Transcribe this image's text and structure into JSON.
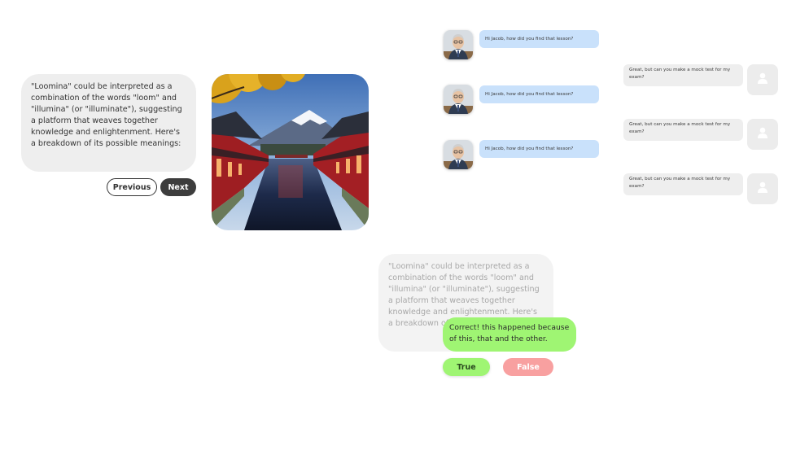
{
  "intro_card": {
    "text": "\"Loomina\" could be interpreted as a combination of the words \"loom\" and \"illumina\" (or \"illuminate\"), suggesting a platform that weaves together knowledge and enlightenment. Here's a breakdown of its possible meanings:"
  },
  "navigation": {
    "previous_label": "Previous",
    "next_label": "Next"
  },
  "chat": {
    "teacher_messages": [
      "Hi Jacob, how did you find that lesson?",
      "Hi Jacob, how did you find that lesson?",
      "Hi Jacob, how did you find that lesson?"
    ],
    "student_messages": [
      "Great, but can you make a mock test for my exam?",
      "Great, but can you make a mock test for my exam?",
      "Great, but can you make a mock test for my exam?"
    ]
  },
  "quiz": {
    "card_text": "\"Loomina\" could be interpreted as a combination of the words \"loom\" and \"illumina\" (or \"illuminate\"), suggesting a platform that weaves together knowledge and enlightenment. Here's a breakdown of its possible meanings:",
    "feedback": "Correct! this happened because of this, that and the other.",
    "true_label": "True",
    "false_label": "False"
  },
  "colors": {
    "dark_button": "#3d3d3d",
    "teacher_bubble": "#c9e1fb",
    "student_bubble": "#eeeeee",
    "correct_green": "#9ff573",
    "false_red": "#f8a0a0"
  }
}
